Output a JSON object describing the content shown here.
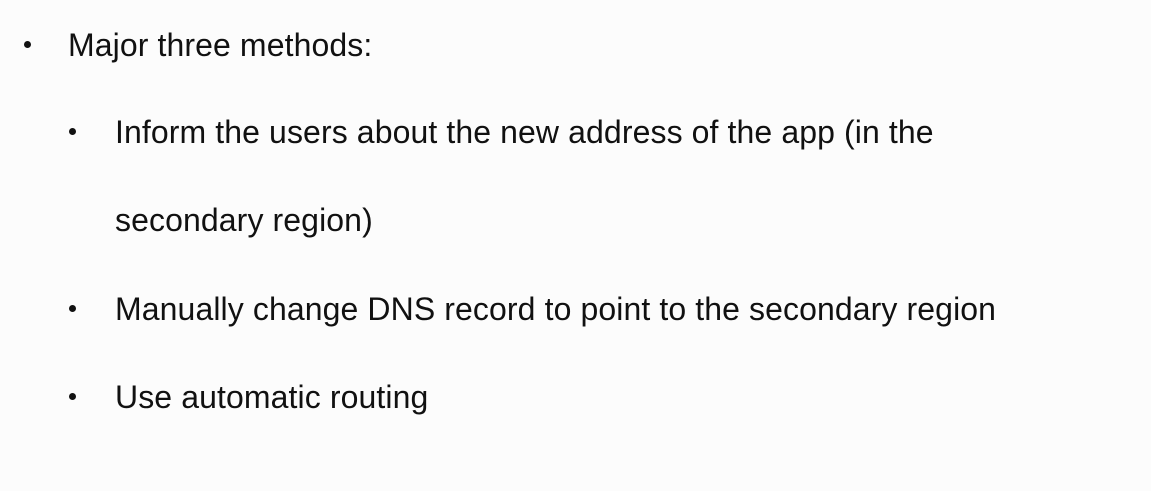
{
  "slide": {
    "main_bullet": "Major three methods:",
    "sub_bullets": [
      "Inform the users about the new address of the app (in the secondary region)",
      "Manually change DNS record to point to the secondary region",
      "Use automatic routing"
    ]
  },
  "colors": {
    "text": "#111111",
    "background": "#fcfcfc"
  }
}
